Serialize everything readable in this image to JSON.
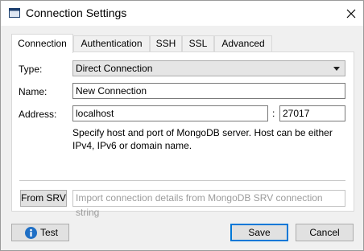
{
  "window": {
    "title": "Connection Settings"
  },
  "tabs": [
    {
      "label": "Connection"
    },
    {
      "label": "Authentication"
    },
    {
      "label": "SSH"
    },
    {
      "label": "SSL"
    },
    {
      "label": "Advanced"
    }
  ],
  "form": {
    "type_label": "Type:",
    "type_value": "Direct Connection",
    "name_label": "Name:",
    "name_value": "New Connection",
    "address_label": "Address:",
    "host_value": "localhost",
    "colon": ":",
    "port_value": "27017",
    "hint": "Specify host and port of MongoDB server. Host can be either IPv4, IPv6 or domain name.",
    "from_srv_label": "From SRV",
    "srv_placeholder": "Import connection details from MongoDB SRV connection string"
  },
  "footer": {
    "test_label": "Test",
    "save_label": "Save",
    "cancel_label": "Cancel"
  },
  "colors": {
    "accent": "#0078d7",
    "info_icon": "#1f6fc5"
  },
  "icons": {
    "app": "window-icon",
    "close": "close-icon",
    "test": "info-icon",
    "dropdown": "chevron-down-icon"
  }
}
